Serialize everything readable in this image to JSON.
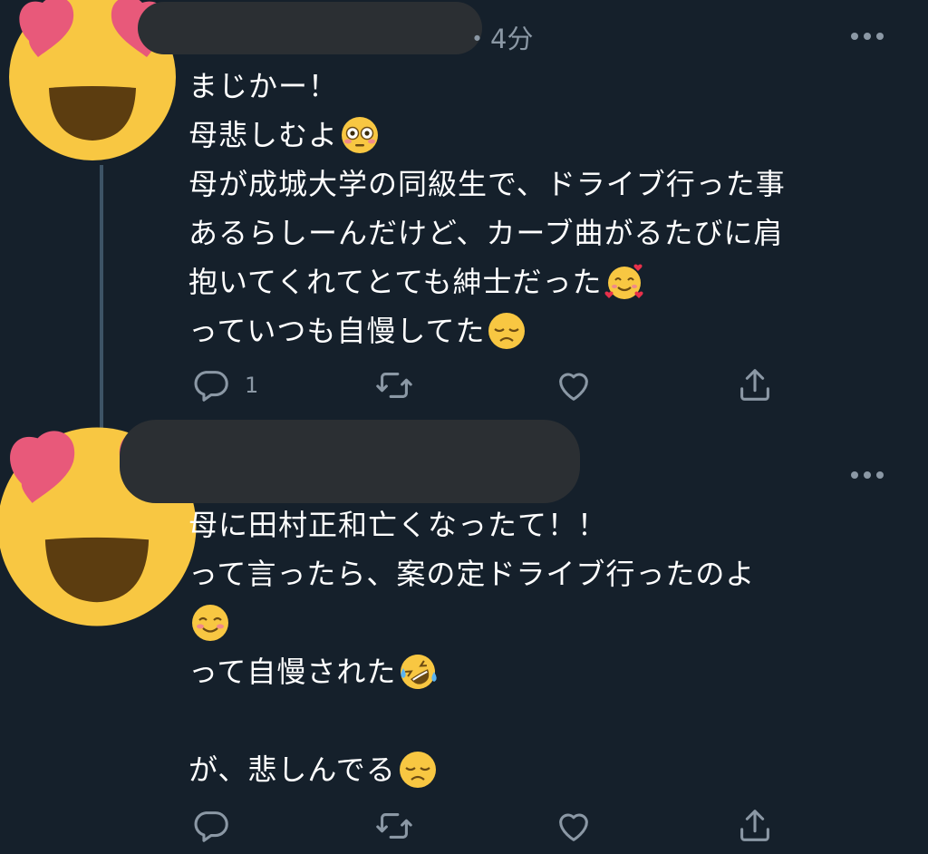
{
  "tweets": [
    {
      "time": "・4分",
      "lines": [
        "まじかー！",
        "母悲しむよ",
        "母が成城大学の同級生で、ドライブ行った事",
        "あるらしーんだけど、カーブ曲がるたびに肩",
        "抱いてくれてとても紳士だった",
        "っていつも自慢してた"
      ],
      "emojis": [
        "flushed-face",
        "smiling-face-with-hearts",
        "disappointed-face"
      ],
      "reply_count": "1"
    },
    {
      "lines": [
        "母に田村正和亡くなったて！！",
        "って言ったら、案の定ドライブ行ったのよ",
        "",
        "って自慢された",
        "",
        "が、悲しんでる"
      ],
      "emojis": [
        "smiling-face",
        "rolling-on-floor-laughing",
        "disappointed-face"
      ],
      "reply_count": ""
    }
  ],
  "colors": {
    "background": "#15202b",
    "text": "#ffffff",
    "muted": "#8b98a5",
    "thread_line": "#3d5466",
    "redaction": "#2b2f33"
  },
  "icons": [
    "heart-eyes-avatar",
    "reply-icon",
    "retweet-icon",
    "like-icon",
    "share-icon",
    "more-icon"
  ]
}
